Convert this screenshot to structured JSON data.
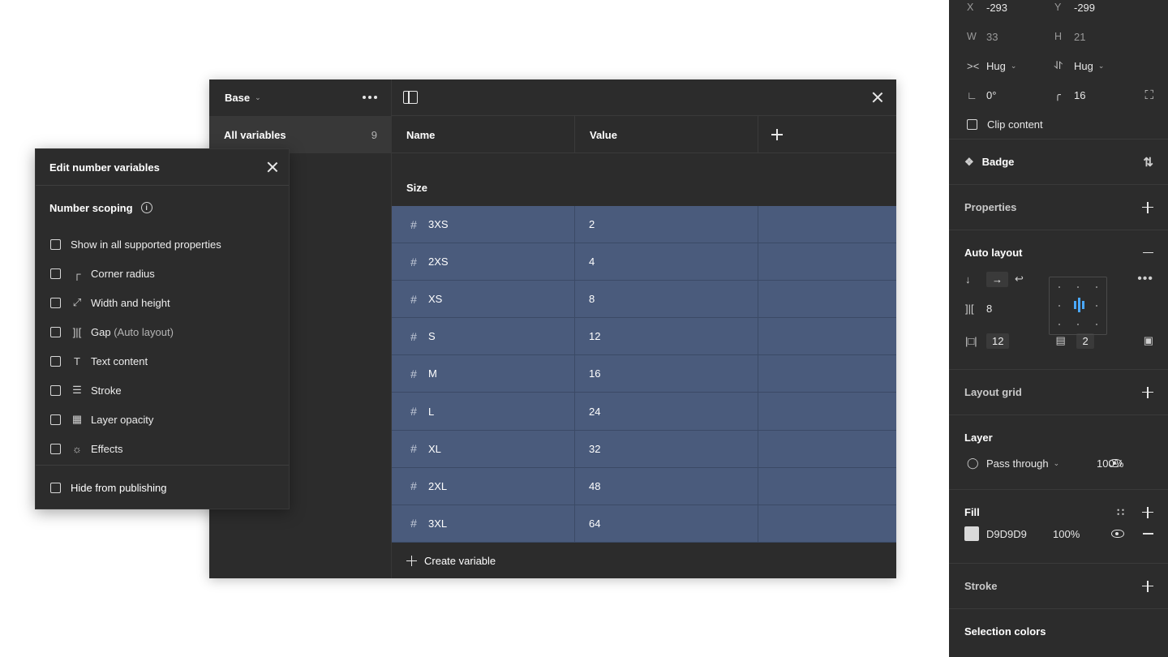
{
  "modal": {
    "collection": "Base",
    "all_variables_label": "All variables",
    "all_variables_count": "9",
    "columns": {
      "name": "Name",
      "value": "Value"
    },
    "group_label": "Size",
    "rows": [
      {
        "name": "3XS",
        "value": "2"
      },
      {
        "name": "2XS",
        "value": "4"
      },
      {
        "name": "XS",
        "value": "8"
      },
      {
        "name": "S",
        "value": "12"
      },
      {
        "name": "M",
        "value": "16"
      },
      {
        "name": "L",
        "value": "24"
      },
      {
        "name": "XL",
        "value": "32"
      },
      {
        "name": "2XL",
        "value": "48"
      },
      {
        "name": "3XL",
        "value": "64"
      }
    ],
    "create_label": "Create variable",
    "selected_row_color": "#4a5b7c"
  },
  "popover": {
    "title": "Edit number variables",
    "scoping_label": "Number scoping",
    "options": [
      {
        "label": "Show in all supported properties",
        "icon": ""
      },
      {
        "label": "Corner radius",
        "icon": "corner-radius-icon"
      },
      {
        "label": "Width and height",
        "icon": "resize-arrow-icon"
      },
      {
        "label": "Gap",
        "suffix": "(Auto layout)",
        "icon": "gap-icon"
      },
      {
        "label": "Text content",
        "icon": "text-icon"
      },
      {
        "label": "Stroke",
        "icon": "stroke-icon"
      },
      {
        "label": "Layer opacity",
        "icon": "opacity-icon"
      },
      {
        "label": "Effects",
        "icon": "effects-icon"
      }
    ],
    "hide_label": "Hide from publishing"
  },
  "panel": {
    "x_label": "X",
    "x": "-293",
    "y_label": "Y",
    "y": "-299",
    "w_label": "W",
    "w": "33",
    "h_label": "H",
    "h": "21",
    "hug_w": "Hug",
    "hug_h": "Hug",
    "rotation": "0°",
    "radius": "16",
    "clip_label": "Clip content",
    "component_name": "Badge",
    "properties_label": "Properties",
    "auto_layout_label": "Auto layout",
    "gap": "8",
    "padding_h": "12",
    "padding_v": "2",
    "layout_grid_label": "Layout grid",
    "layer_label": "Layer",
    "blend_mode": "Pass through",
    "layer_opacity": "100%",
    "fill_label": "Fill",
    "fill_hex": "D9D9D9",
    "fill_color": "#d9d9d9",
    "fill_opacity": "100%",
    "stroke_label": "Stroke",
    "selection_colors_label": "Selection colors"
  }
}
